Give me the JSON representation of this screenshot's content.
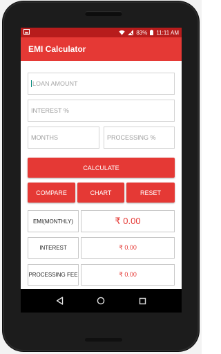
{
  "status_bar": {
    "battery_percent": "83%",
    "time": "11:11 AM"
  },
  "toolbar": {
    "title": "EMI Calculator"
  },
  "form": {
    "loan_amount_placeholder": "LOAN AMOUNT",
    "interest_placeholder": "INTEREST %",
    "months_placeholder": "MONTHS",
    "processing_placeholder": "PROCESSING %"
  },
  "buttons": {
    "calculate": "CALCULATE",
    "compare": "COMPARE",
    "chart": "CHART",
    "reset": "RESET"
  },
  "results": [
    {
      "label": "EMI(MONTHLY)",
      "value": "₹ 0.00"
    },
    {
      "label": "INTEREST",
      "value": "₹ 0.00"
    },
    {
      "label": "PROCESSING FEE",
      "value": "₹ 0.00"
    }
  ],
  "colors": {
    "accent": "#e53935",
    "status_bar": "#b71c1c"
  },
  "icons": [
    "notification-image-icon",
    "wifi-icon",
    "signal-icon",
    "battery-icon",
    "back-icon",
    "home-icon",
    "recents-icon"
  ]
}
